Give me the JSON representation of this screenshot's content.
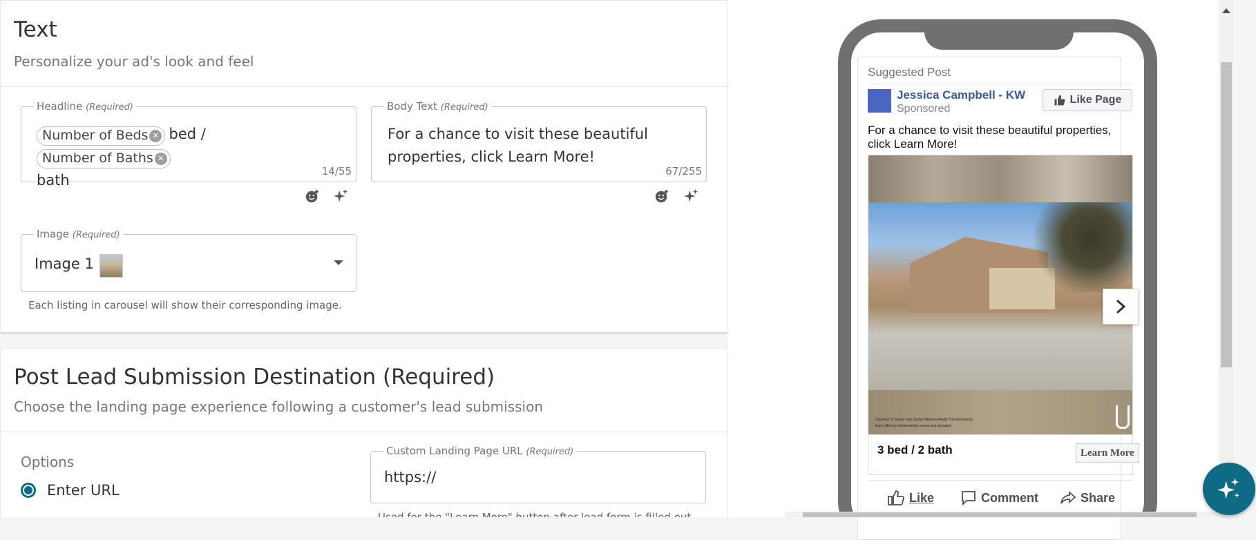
{
  "text_section": {
    "title": "Text",
    "subtitle": "Personalize your ad's look and feel",
    "headline": {
      "label": "Headline",
      "required": "(Required)",
      "chip1": "Number of Beds",
      "mid_text": "bed /",
      "chip2": "Number of Baths",
      "end_text": "bath",
      "counter": "14/55"
    },
    "body_text": {
      "label": "Body Text",
      "required": "(Required)",
      "value_line1": "For a chance to visit these beautiful",
      "value_line2": "properties, click Learn More!",
      "counter": "67/255"
    },
    "image": {
      "label": "Image",
      "required": "(Required)",
      "value": "Image 1",
      "helper": "Each listing in carousel will show their corresponding image."
    }
  },
  "destination_section": {
    "title": "Post Lead Submission Destination (Required)",
    "subtitle": "Choose the landing page experience following a customer's lead submission",
    "options_label": "Options",
    "radio_label": "Enter URL",
    "url_field": {
      "label": "Custom Landing Page URL",
      "required": "(Required)",
      "value": "https://",
      "helper": "Used for the \"Learn More\" button after lead form is filled out"
    }
  },
  "preview": {
    "suggested": "Suggested Post",
    "page_name": "Jessica Campbell - KW",
    "sponsored": "Sponsored",
    "like_page": "Like Page",
    "post_text_line1": "For a chance to visit these beautiful properties,",
    "post_text_line2": "click Learn More!",
    "card_title": "3 bed / 2 bath",
    "learn_more": "Learn More",
    "disclaimer_line1": "Courtesy of Tanner Kyle (Keller Williams Realty The Woodlands",
    "disclaimer_line2": "Each office is independently owned and operated.",
    "action_like": "Like",
    "action_comment": "Comment",
    "action_share": "Share"
  },
  "colors": {
    "accent": "#0f6a86",
    "facebook_blue": "#3b5998",
    "phone_frame": "#707070"
  }
}
